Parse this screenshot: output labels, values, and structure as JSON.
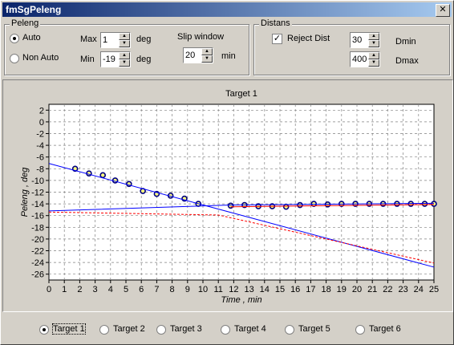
{
  "window": {
    "title": "fmSgPeleng",
    "close_icon": "close-icon"
  },
  "peleng": {
    "title": "Peleng",
    "auto_label": "Auto",
    "non_auto_label": "Non Auto",
    "mode": "Auto",
    "max_label": "Max",
    "max_value": "1",
    "min_label": "Min",
    "min_value": "-19",
    "deg_unit": "deg",
    "slip_label": "Slip window",
    "slip_value": "20",
    "slip_unit": "min"
  },
  "distans": {
    "title": "Distans",
    "reject_label": "Reject Dist",
    "reject_checked": true,
    "dmin_value": "30",
    "dmin_label": "Dmin",
    "dmax_value": "400",
    "dmax_label": "Dmax"
  },
  "chart_data": {
    "type": "line",
    "title": "Target 1",
    "xlabel": "Time , min",
    "ylabel": "Peleng , deg",
    "xlim": [
      0,
      25
    ],
    "ylim": [
      -27,
      3
    ],
    "xticks": [
      0,
      1,
      2,
      3,
      4,
      5,
      6,
      7,
      8,
      9,
      10,
      11,
      12,
      13,
      14,
      15,
      16,
      17,
      18,
      19,
      20,
      21,
      22,
      23,
      24,
      25
    ],
    "yticks": [
      2,
      0,
      -2,
      -4,
      -6,
      -8,
      -10,
      -12,
      -14,
      -16,
      -18,
      -20,
      -22,
      -24,
      -26
    ],
    "grid": true,
    "series": [
      {
        "style": "markers",
        "color": "#000080",
        "x": [
          1.7,
          2.6,
          3.5,
          4.3,
          5.2,
          6.1,
          7.0,
          7.9,
          8.8,
          9.7,
          11.8,
          12.7,
          13.6,
          14.5,
          15.4,
          16.3,
          17.2,
          18.1,
          19.0,
          19.9,
          20.8,
          21.7,
          22.6,
          23.5,
          24.4,
          25.0
        ],
        "y": [
          -8.0,
          -8.8,
          -9.1,
          -10.0,
          -10.6,
          -11.8,
          -12.3,
          -12.6,
          -13.1,
          -14.0,
          -14.3,
          -14.2,
          -14.4,
          -14.4,
          -14.5,
          -14.2,
          -14.0,
          -14.1,
          -14.0,
          -14.0,
          -14.0,
          -14.0,
          -14.0,
          -14.0,
          -14.0,
          -14.0
        ]
      },
      {
        "style": "line",
        "color": "#0000ff",
        "x": [
          0,
          25
        ],
        "y": [
          -7.1,
          -24.8
        ]
      },
      {
        "style": "line",
        "color": "#0000ff",
        "x": [
          0,
          11.8,
          25
        ],
        "y": [
          -15.2,
          -14.2,
          -13.9
        ]
      },
      {
        "style": "line",
        "color": "#ff0000",
        "x": [
          11.8,
          25
        ],
        "y": [
          -14.5,
          -14.1
        ]
      },
      {
        "style": "dashed",
        "color": "#ff0000",
        "x": [
          0,
          11,
          25
        ],
        "y": [
          -15.4,
          -15.9,
          -24.1
        ]
      }
    ]
  },
  "targets": [
    {
      "label": "Target 1",
      "selected": true
    },
    {
      "label": "Target 2",
      "selected": false
    },
    {
      "label": "Target 3",
      "selected": false
    },
    {
      "label": "Target 4",
      "selected": false
    },
    {
      "label": "Target 5",
      "selected": false
    },
    {
      "label": "Target 6",
      "selected": false
    }
  ]
}
